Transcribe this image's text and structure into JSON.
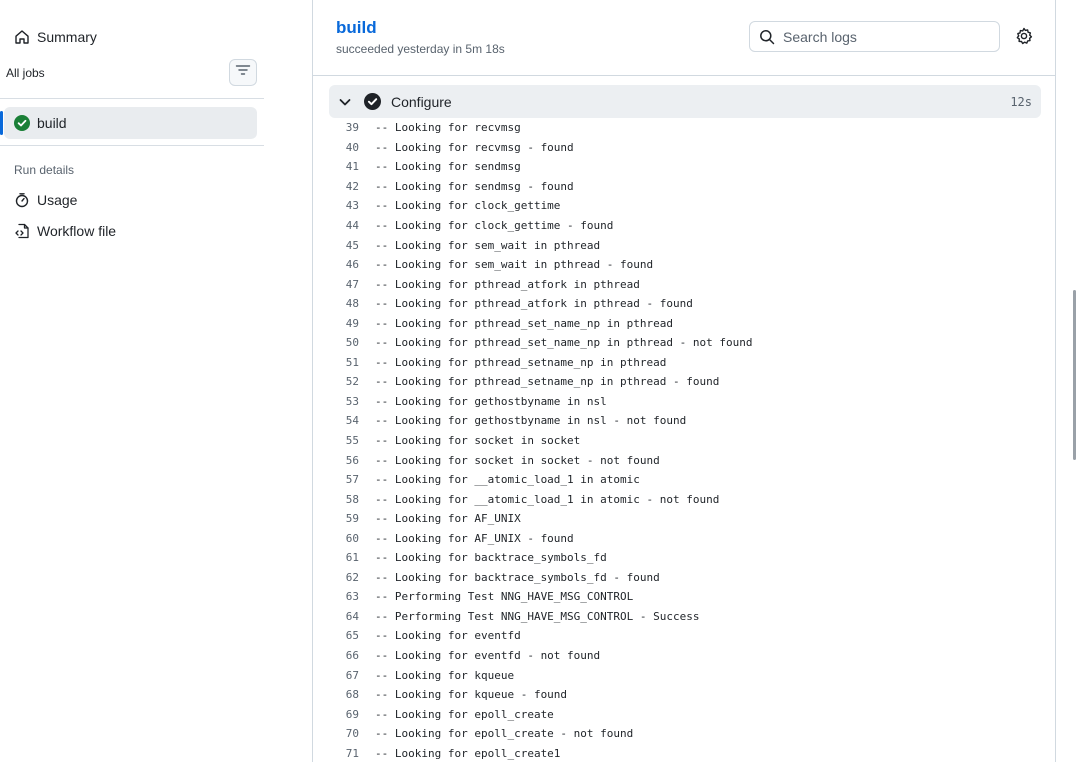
{
  "sidebar": {
    "summary_label": "Summary",
    "all_jobs_label": "All jobs",
    "jobs": [
      {
        "label": "build",
        "status": "success"
      }
    ],
    "run_details_label": "Run details",
    "usage_label": "Usage",
    "workflow_file_label": "Workflow file"
  },
  "job": {
    "title": "build",
    "subtitle": "succeeded yesterday in 5m 18s",
    "search_placeholder": "Search logs"
  },
  "step": {
    "name": "Configure",
    "duration": "12s",
    "status": "success"
  },
  "log_lines": [
    {
      "n": "39",
      "t": "-- Looking for recvmsg"
    },
    {
      "n": "40",
      "t": "-- Looking for recvmsg - found"
    },
    {
      "n": "41",
      "t": "-- Looking for sendmsg"
    },
    {
      "n": "42",
      "t": "-- Looking for sendmsg - found"
    },
    {
      "n": "43",
      "t": "-- Looking for clock_gettime"
    },
    {
      "n": "44",
      "t": "-- Looking for clock_gettime - found"
    },
    {
      "n": "45",
      "t": "-- Looking for sem_wait in pthread"
    },
    {
      "n": "46",
      "t": "-- Looking for sem_wait in pthread - found"
    },
    {
      "n": "47",
      "t": "-- Looking for pthread_atfork in pthread"
    },
    {
      "n": "48",
      "t": "-- Looking for pthread_atfork in pthread - found"
    },
    {
      "n": "49",
      "t": "-- Looking for pthread_set_name_np in pthread"
    },
    {
      "n": "50",
      "t": "-- Looking for pthread_set_name_np in pthread - not found"
    },
    {
      "n": "51",
      "t": "-- Looking for pthread_setname_np in pthread"
    },
    {
      "n": "52",
      "t": "-- Looking for pthread_setname_np in pthread - found"
    },
    {
      "n": "53",
      "t": "-- Looking for gethostbyname in nsl"
    },
    {
      "n": "54",
      "t": "-- Looking for gethostbyname in nsl - not found"
    },
    {
      "n": "55",
      "t": "-- Looking for socket in socket"
    },
    {
      "n": "56",
      "t": "-- Looking for socket in socket - not found"
    },
    {
      "n": "57",
      "t": "-- Looking for __atomic_load_1 in atomic"
    },
    {
      "n": "58",
      "t": "-- Looking for __atomic_load_1 in atomic - not found"
    },
    {
      "n": "59",
      "t": "-- Looking for AF_UNIX"
    },
    {
      "n": "60",
      "t": "-- Looking for AF_UNIX - found"
    },
    {
      "n": "61",
      "t": "-- Looking for backtrace_symbols_fd"
    },
    {
      "n": "62",
      "t": "-- Looking for backtrace_symbols_fd - found"
    },
    {
      "n": "63",
      "t": "-- Performing Test NNG_HAVE_MSG_CONTROL"
    },
    {
      "n": "64",
      "t": "-- Performing Test NNG_HAVE_MSG_CONTROL - Success"
    },
    {
      "n": "65",
      "t": "-- Looking for eventfd"
    },
    {
      "n": "66",
      "t": "-- Looking for eventfd - not found"
    },
    {
      "n": "67",
      "t": "-- Looking for kqueue"
    },
    {
      "n": "68",
      "t": "-- Looking for kqueue - found"
    },
    {
      "n": "69",
      "t": "-- Looking for epoll_create"
    },
    {
      "n": "70",
      "t": "-- Looking for epoll_create - not found"
    },
    {
      "n": "71",
      "t": "-- Looking for epoll_create1"
    }
  ],
  "colors": {
    "link": "#0969da",
    "success": "#1a7f37",
    "muted": "#59636e",
    "step_bg": "#eceff2"
  },
  "icons": {
    "summary": "home-icon",
    "filter": "filter-lines-icon",
    "job_status": "check-circle-fill-icon",
    "usage": "stopwatch-icon",
    "workflow": "file-code-icon",
    "search": "search-icon",
    "settings": "gear-icon",
    "collapse": "chevron-down-icon"
  }
}
